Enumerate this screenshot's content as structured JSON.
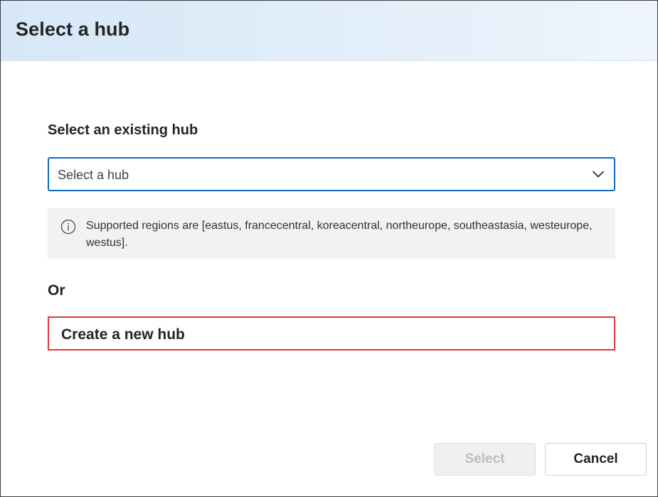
{
  "dialog": {
    "title": "Select a hub"
  },
  "existing_hub": {
    "label": "Select an existing hub",
    "dropdown_placeholder": "Select a hub",
    "chevron_icon": "chevron-down-icon"
  },
  "info": {
    "icon": "info-icon",
    "text": "Supported regions are [eastus, francecentral, koreacentral, northeurope, southeastasia, westeurope, westus]."
  },
  "or_label": "Or",
  "create_hub": {
    "label": "Create a new hub"
  },
  "footer": {
    "select_label": "Select",
    "select_disabled": true,
    "cancel_label": "Cancel"
  },
  "colors": {
    "header_background": "#dbe9f8",
    "focus_border": "#0f6cbd",
    "highlight_border": "#e0383e",
    "info_background": "#f3f2f1",
    "disabled_text": "#bdbdbd"
  }
}
